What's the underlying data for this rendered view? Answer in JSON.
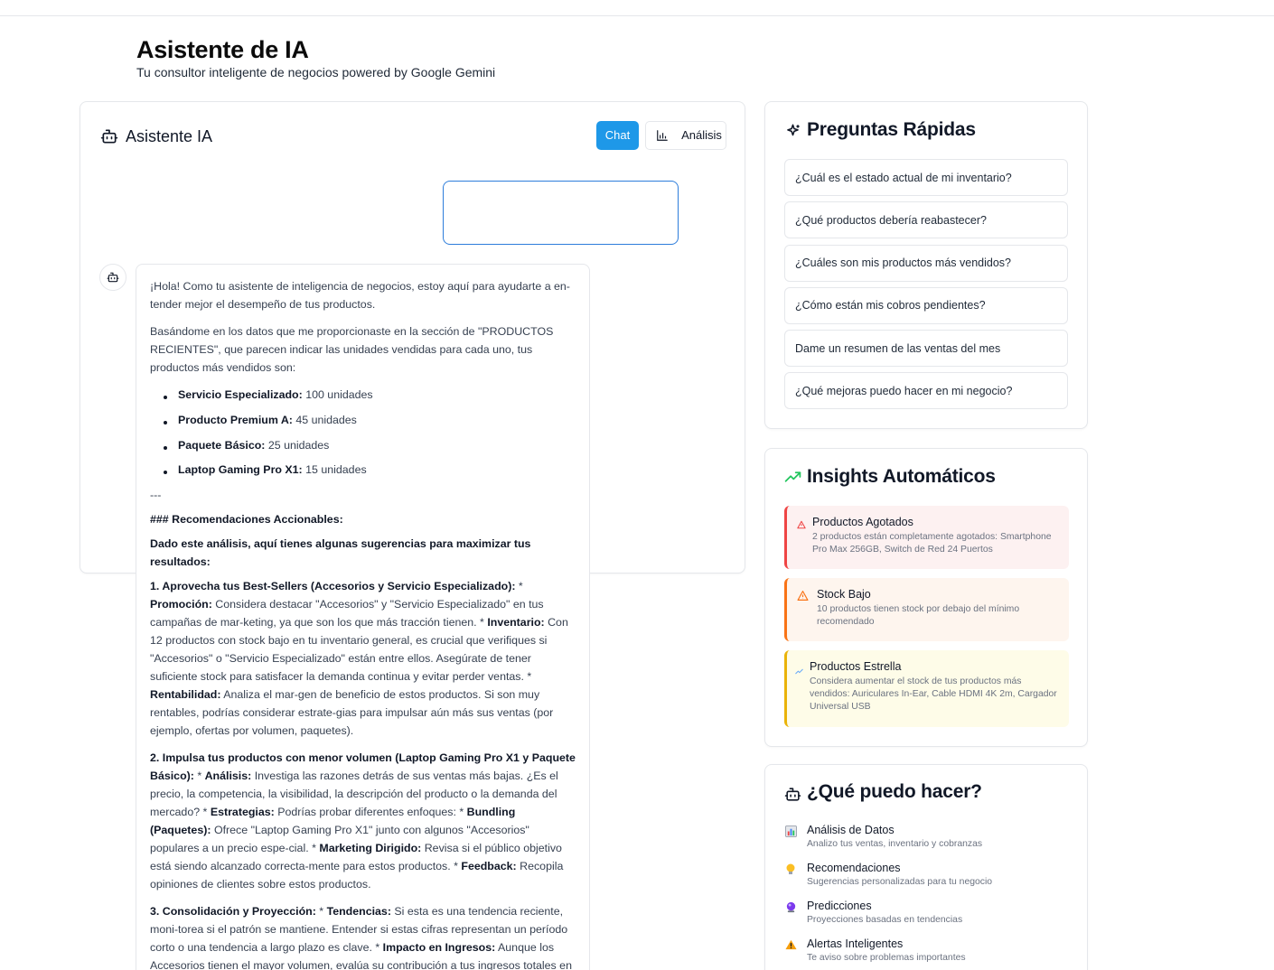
{
  "page": {
    "title": "Asistente de IA",
    "subtitle": "Tu consultor inteligente de negocios powered by Google Gemini"
  },
  "chat": {
    "title": "Asistente IA",
    "tab_chat": "Chat",
    "tab_analysis": "Análisis",
    "user_message": "",
    "bot": {
      "intro": "¡Hola! Como tu asistente de inteligencia de negocios, estoy aquí para ayudarte a en-tender mejor el desempeño de tus productos.",
      "para2": "Basándome en los datos que me proporcionaste en la sección de \"PRODUCTOS RECIENTES\", que parecen indicar las unidades vendidas para cada uno, tus productos más vendidos son:",
      "top_products": [
        {
          "name": "Servicio Especializado:",
          "value": "100 unidades"
        },
        {
          "name": "Producto Premium A:",
          "value": "45 unidades"
        },
        {
          "name": "Paquete Básico:",
          "value": "25 unidades"
        },
        {
          "name": "Laptop Gaming Pro X1:",
          "value": "15 unidades"
        }
      ],
      "separator": "---",
      "heading": "### Recomendaciones Accionables:",
      "lead": "Dado este análisis, aquí tienes algunas sugerencias para maximizar tus resultados:",
      "rec1": {
        "title": "1. Aprovecha tus Best-Sellers (Accesorios y Servicio Especializado):",
        "s1_label": "Promoción:",
        "s1_text": "Considera destacar \"Accesorios\" y \"Servicio Especializado\" en tus campañas de mar-keting, ya que son los que más tracción tienen.",
        "s2_label": "Inventario:",
        "s2_text": "Con 12 productos con stock bajo en tu inventario general, es crucial que verifiques si \"Accesorios\" o \"Servicio Especializado\" están entre ellos. Asegúrate de tener suficiente stock para satisfacer la demanda continua y evitar perder ventas.",
        "s3_label": "Rentabilidad:",
        "s3_text": "Analiza el mar-gen de beneficio de estos productos. Si son muy rentables, podrías considerar estrate-gias para impulsar aún más sus ventas (por ejemplo, ofertas por volumen, paquetes)."
      },
      "rec2": {
        "title": "2. Impulsa tus productos con menor volumen (Laptop Gaming Pro X1 y Paquete Básico):",
        "s1_label": "Análisis:",
        "s1_text": "Investiga las razones detrás de sus ventas más bajas. ¿Es el precio, la competencia, la visibilidad, la descripción del producto o la demanda del mercado?",
        "s2_label": "Estrategias:",
        "s2_text": "Podrías probar diferentes enfoques:",
        "s3_label": "Bundling (Paquetes):",
        "s3_text": "Ofrece \"Laptop Gaming Pro X1\" junto con algunos \"Accesorios\" populares a un precio espe-cial.",
        "s4_label": "Marketing Dirigido:",
        "s4_text": "Revisa si el público objetivo está siendo alcanzado correcta-mente para estos productos.",
        "s5_label": "Feedback:",
        "s5_text": "Recopila opiniones de clientes sobre estos productos."
      },
      "rec3": {
        "title": "3. Consolidación y Proyección:",
        "s1_label": "Tendencias:",
        "s1_text": "Si esta es una tendencia reciente, moni-torea si el patrón se mantiene. Entender si estas cifras representan un período corto o una tendencia a largo plazo es clave.",
        "s2_label": "Impacto en Ingresos:",
        "s2_text": "Aunque los Accesorios tienen el mayor volumen, evalúa su contribución a tus ingresos totales en comparación con el \"Servicio Especializado\" o el \"Producto Premium A\", que podrían tener un precio unitario más alto."
      }
    }
  },
  "quick": {
    "title": "Preguntas Rápidas",
    "questions": [
      "¿Cuál es el estado actual de mi inventario?",
      "¿Qué productos debería reabastecer?",
      "¿Cuáles son mis productos más vendidos?",
      "¿Cómo están mis cobros pendientes?",
      "Dame un resumen de las ventas del mes",
      "¿Qué mejoras puedo hacer en mi negocio?"
    ]
  },
  "insights": {
    "title": "Insights Automáticos",
    "items": [
      {
        "title": "Productos Agotados",
        "desc": "2 productos están completamente agotados: Smartphone Pro Max 256GB, Switch de Red 24 Puertos",
        "color": "#ef4444"
      },
      {
        "title": "Stock Bajo",
        "desc": "10 productos tienen stock por debajo del mínimo recomendado",
        "color": "#f97316"
      },
      {
        "title": "Productos Estrella",
        "desc": "Considera aumentar el stock de tus productos más vendidos: Auriculares In-Ear, Cable HDMI 4K 2m, Cargador Universal USB",
        "color": "#eab308"
      }
    ]
  },
  "capabilities": {
    "title": "¿Qué puedo hacer?",
    "items": [
      {
        "icon": "bar-chart-emoji",
        "title": "Análisis de Datos",
        "desc": "Analizo tus ventas, inventario y cobranzas"
      },
      {
        "icon": "lightbulb-emoji",
        "title": "Recomendaciones",
        "desc": "Sugerencias personalizadas para tu negocio"
      },
      {
        "icon": "crystal-ball-emoji",
        "title": "Predicciones",
        "desc": "Proyecciones basadas en tendencias"
      },
      {
        "icon": "warning-emoji",
        "title": "Alertas Inteligentes",
        "desc": "Te aviso sobre problemas importantes"
      }
    ]
  },
  "colors": {
    "accent": "#1e98e8",
    "user_bubble_border": "#2d7ddb",
    "trend_green": "#22c55e"
  }
}
